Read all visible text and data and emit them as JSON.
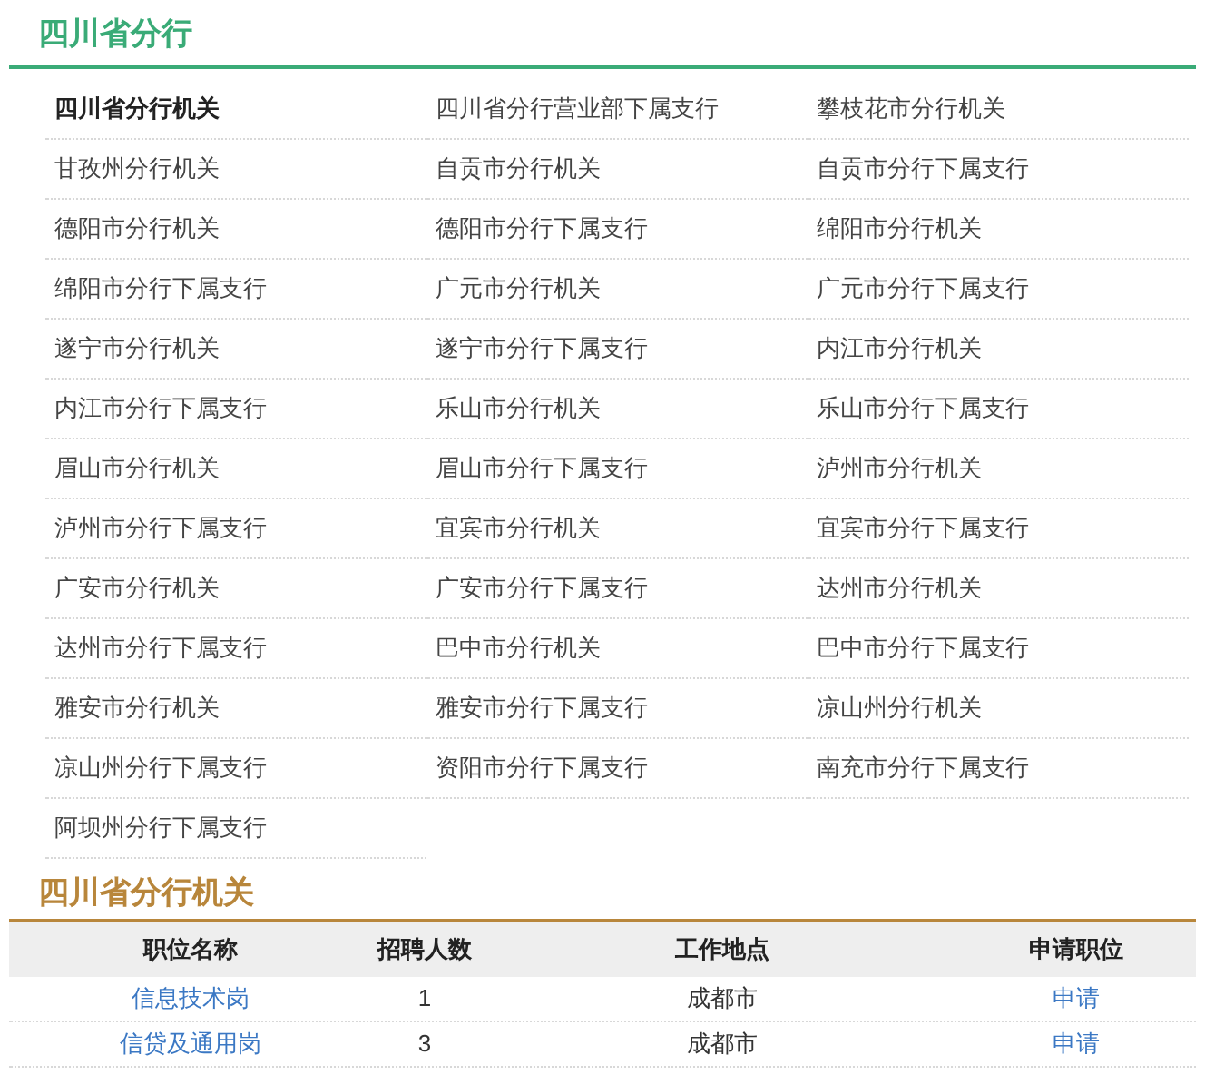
{
  "branch_section": {
    "title": "四川省分行"
  },
  "branches": [
    {
      "label": "四川省分行机关",
      "selected": true
    },
    {
      "label": "四川省分行营业部下属支行",
      "selected": false
    },
    {
      "label": "攀枝花市分行机关",
      "selected": false
    },
    {
      "label": "甘孜州分行机关",
      "selected": false
    },
    {
      "label": "自贡市分行机关",
      "selected": false
    },
    {
      "label": "自贡市分行下属支行",
      "selected": false
    },
    {
      "label": "德阳市分行机关",
      "selected": false
    },
    {
      "label": "德阳市分行下属支行",
      "selected": false
    },
    {
      "label": "绵阳市分行机关",
      "selected": false
    },
    {
      "label": "绵阳市分行下属支行",
      "selected": false
    },
    {
      "label": "广元市分行机关",
      "selected": false
    },
    {
      "label": "广元市分行下属支行",
      "selected": false
    },
    {
      "label": "遂宁市分行机关",
      "selected": false
    },
    {
      "label": "遂宁市分行下属支行",
      "selected": false
    },
    {
      "label": "内江市分行机关",
      "selected": false
    },
    {
      "label": "内江市分行下属支行",
      "selected": false
    },
    {
      "label": "乐山市分行机关",
      "selected": false
    },
    {
      "label": "乐山市分行下属支行",
      "selected": false
    },
    {
      "label": "眉山市分行机关",
      "selected": false
    },
    {
      "label": "眉山市分行下属支行",
      "selected": false
    },
    {
      "label": "泸州市分行机关",
      "selected": false
    },
    {
      "label": "泸州市分行下属支行",
      "selected": false
    },
    {
      "label": "宜宾市分行机关",
      "selected": false
    },
    {
      "label": "宜宾市分行下属支行",
      "selected": false
    },
    {
      "label": "广安市分行机关",
      "selected": false
    },
    {
      "label": "广安市分行下属支行",
      "selected": false
    },
    {
      "label": "达州市分行机关",
      "selected": false
    },
    {
      "label": "达州市分行下属支行",
      "selected": false
    },
    {
      "label": "巴中市分行机关",
      "selected": false
    },
    {
      "label": "巴中市分行下属支行",
      "selected": false
    },
    {
      "label": "雅安市分行机关",
      "selected": false
    },
    {
      "label": "雅安市分行下属支行",
      "selected": false
    },
    {
      "label": "凉山州分行机关",
      "selected": false
    },
    {
      "label": "凉山州分行下属支行",
      "selected": false
    },
    {
      "label": "资阳市分行下属支行",
      "selected": false
    },
    {
      "label": "南充市分行下属支行",
      "selected": false
    },
    {
      "label": "阿坝州分行下属支行",
      "selected": false
    }
  ],
  "jobs_section": {
    "title": "四川省分行机关"
  },
  "table": {
    "columns": [
      "职位名称",
      "招聘人数",
      "工作地点",
      "申请职位"
    ],
    "rows": [
      {
        "position": "信息技术岗",
        "count": "1",
        "location": "成都市",
        "action": "申请"
      },
      {
        "position": "信贷及通用岗",
        "count": "3",
        "location": "成都市",
        "action": "申请"
      }
    ]
  }
}
